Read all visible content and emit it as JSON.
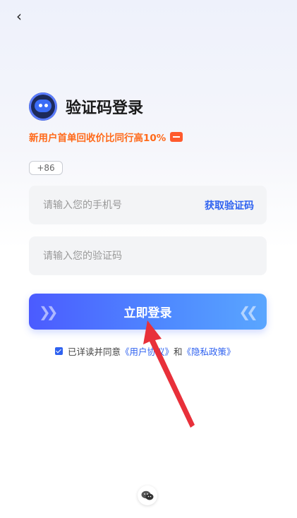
{
  "nav": {
    "back_icon": "chevron-left-icon"
  },
  "header": {
    "logo_icon": "robot-avatar-icon",
    "title": "验证码登录"
  },
  "promo": {
    "text": "新用户首单回收价比同行高10%",
    "chip_icon": "red-packet-icon",
    "color": "#ff6a1a"
  },
  "form": {
    "country_code": "+86",
    "phone_placeholder": "请输入您的手机号",
    "get_code_label": "获取验证码",
    "code_placeholder": "请输入您的验证码",
    "login_label": "立即登录"
  },
  "agreement": {
    "checked": true,
    "prefix": "已详读并同意",
    "user_agreement": "《用户协议》",
    "conjunction": "和",
    "privacy_policy": "《隐私政策》"
  },
  "footer": {
    "wechat_icon": "wechat-icon"
  },
  "colors": {
    "accent": "#2f62f0",
    "promo": "#ff6a1a",
    "annotation_arrow": "#e8303a"
  }
}
